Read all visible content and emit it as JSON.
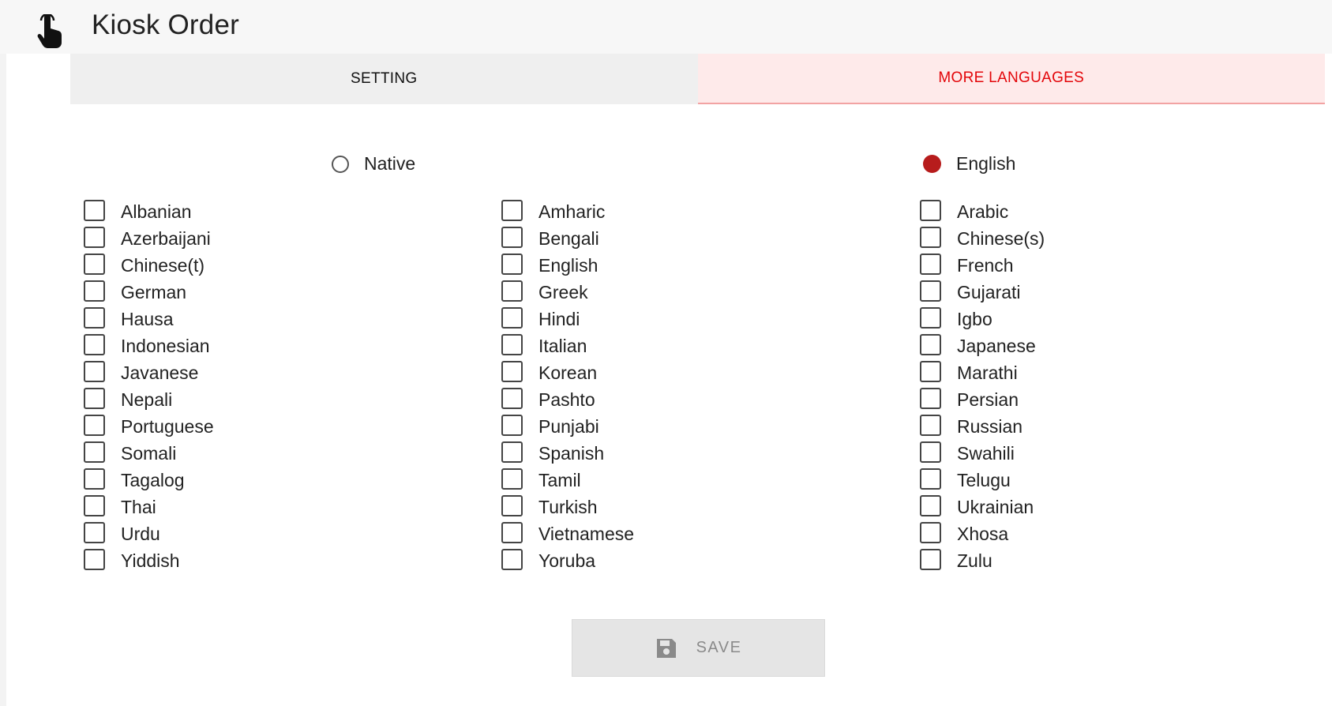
{
  "header": {
    "title": "Kiosk Order",
    "icon": "touch-hand-icon"
  },
  "tabs": [
    {
      "label": "SETTING",
      "active": false
    },
    {
      "label": "MORE LANGUAGES",
      "active": true
    }
  ],
  "display_mode": {
    "options": [
      {
        "label": "Native",
        "selected": false
      },
      {
        "label": "English",
        "selected": true
      }
    ]
  },
  "languages": {
    "columns": [
      [
        "Albanian",
        "Azerbaijani",
        "Chinese(t)",
        "German",
        "Hausa",
        "Indonesian",
        "Javanese",
        "Nepali",
        "Portuguese",
        "Somali",
        "Tagalog",
        "Thai",
        "Urdu",
        "Yiddish"
      ],
      [
        "Amharic",
        "Bengali",
        "English",
        "Greek",
        "Hindi",
        "Italian",
        "Korean",
        "Pashto",
        "Punjabi",
        "Spanish",
        "Tamil",
        "Turkish",
        "Vietnamese",
        "Yoruba"
      ],
      [
        "Arabic",
        "Chinese(s)",
        "French",
        "Gujarati",
        "Igbo",
        "Japanese",
        "Marathi",
        "Persian",
        "Russian",
        "Swahili",
        "Telugu",
        "Ukrainian",
        "Xhosa",
        "Zulu"
      ]
    ],
    "checked": []
  },
  "save": {
    "label": "SAVE",
    "icon": "floppy-disk-icon",
    "disabled": true
  },
  "colors": {
    "accent": "#e3060a",
    "radio_selected": "#b71c1c",
    "active_tab_bg": "#feeaea"
  }
}
